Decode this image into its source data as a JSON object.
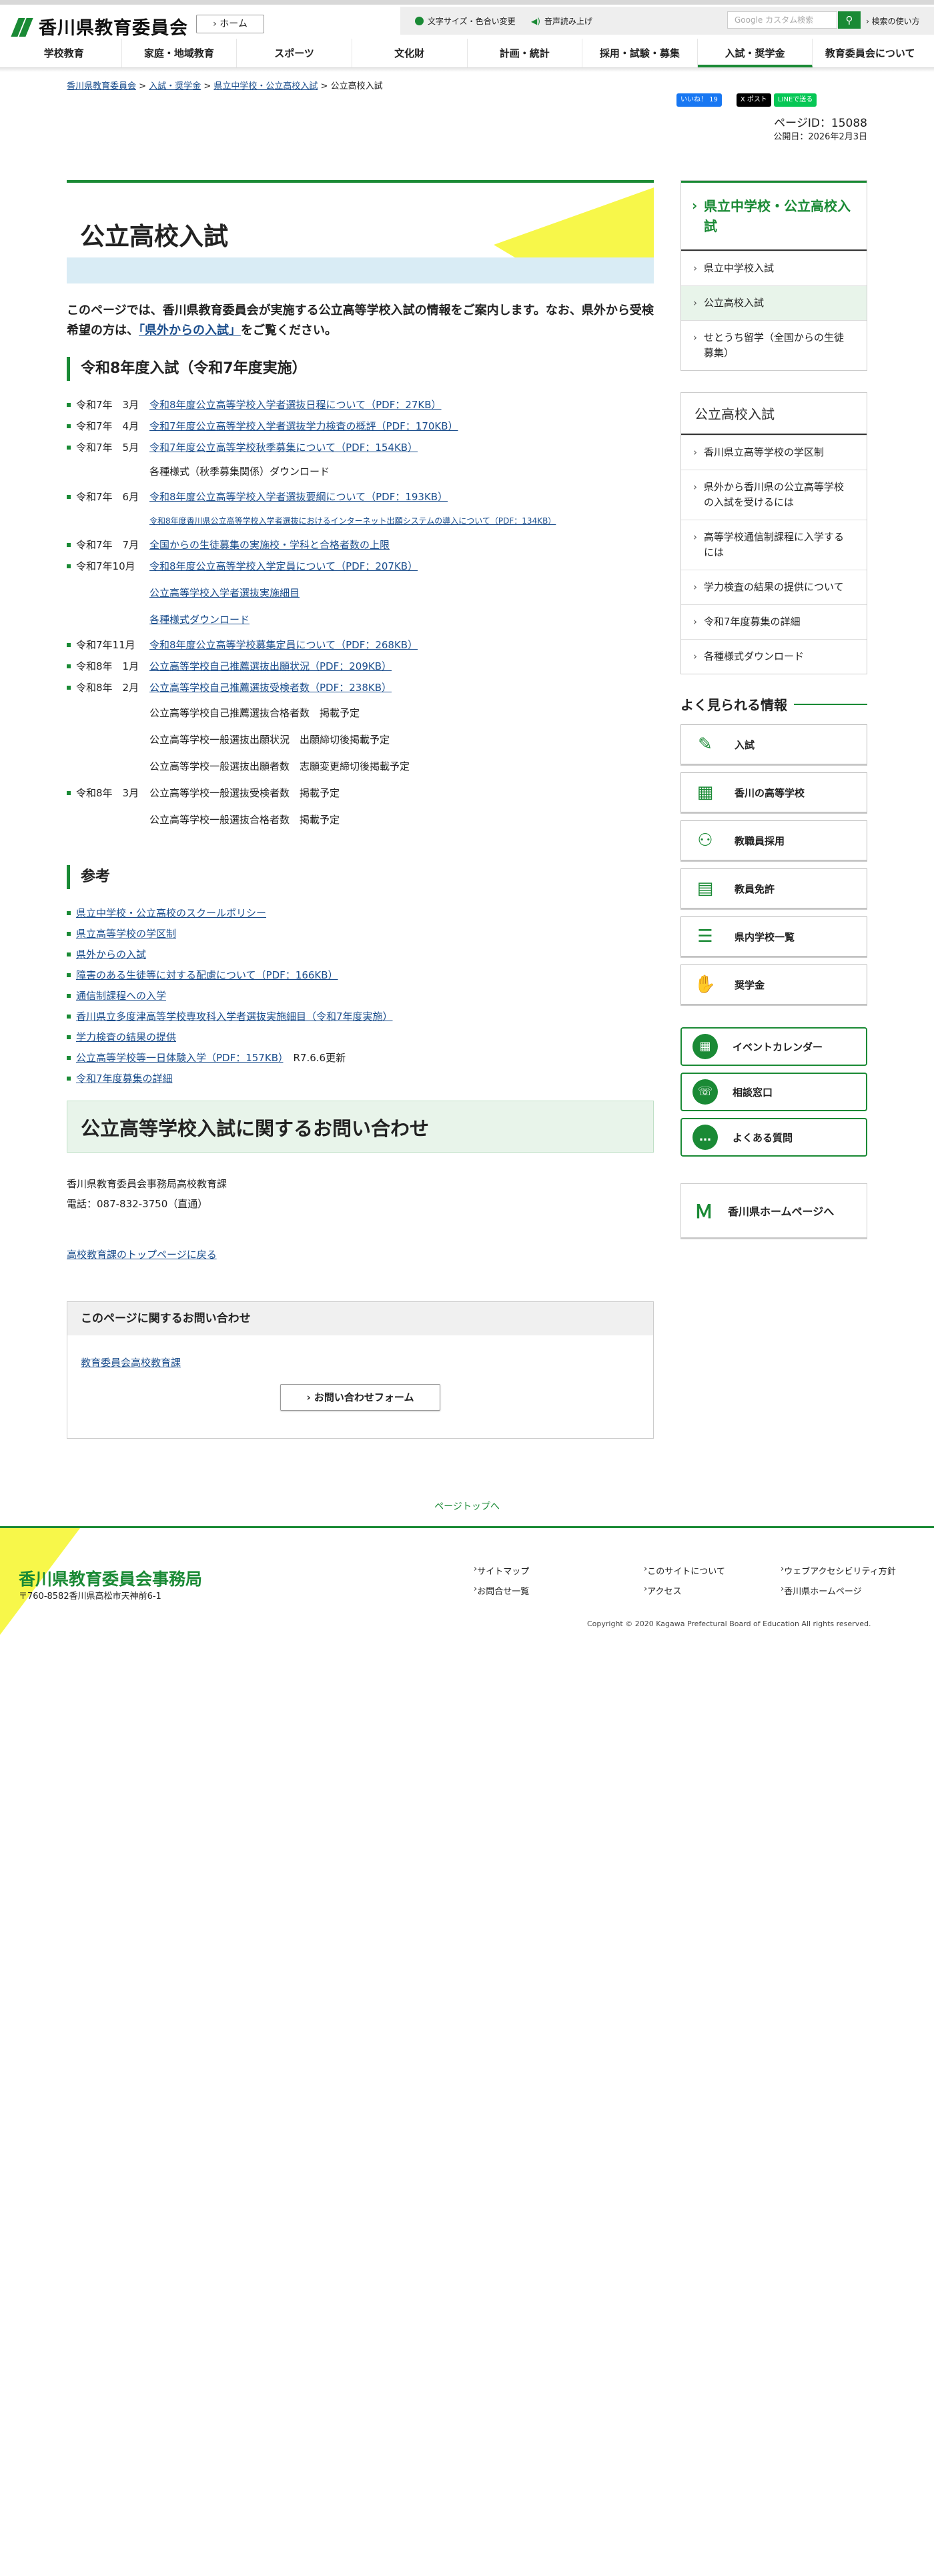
{
  "header": {
    "site_title": "香川県教育委員会",
    "home_label": "ホーム",
    "text_size": "文字サイズ・色合い変更",
    "voice": "音声読み上げ",
    "search_placeholder": "Google カスタム検索",
    "search_help": "検索の使い方"
  },
  "nav": [
    "学校教育",
    "家庭・地域教育",
    "スポーツ",
    "文化財",
    "計画・統計",
    "採用・試験・募集",
    "入試・奨学金",
    "教育委員会について"
  ],
  "breadcrumb": [
    "香川県教育委員会",
    "入試・奨学金",
    "県立中学校・公立高校入試",
    "公立高校入試"
  ],
  "sns": {
    "like": "いいね！ 19",
    "post": "X ポスト",
    "line": "LINEで送る"
  },
  "page_id": "ページID：15088",
  "published": "公開日：2026年2月3日",
  "main": {
    "title": "公立高校入試",
    "lead": "このページでは、香川県教育委員会が実施する公立高等学校入試の情報をご案内します。なお、県外から受検希望の方は、",
    "lead_link": "「県外からの入試」",
    "lead_end": "をご覧ください。",
    "section_title": "令和8年度入試（令和7年度実施）",
    "items": [
      {
        "date": "令和7年　3月",
        "text": "令和8年度公立高等学校入学者選抜日程について（PDF：27KB）"
      },
      {
        "date": "令和7年　4月",
        "text": "令和7年度公立高等学校入学者選抜学力検査の概評（PDF：170KB）"
      },
      {
        "date": "令和7年　5月",
        "text": "令和7年度公立高等学校秋季募集について（PDF：154KB）"
      },
      {
        "date": "令和7年　6月",
        "text": "令和8年度公立高等学校入学者選抜要綱について（PDF：193KB）"
      },
      {
        "date": "令和7年　7月",
        "text": "全国からの生徒募集の実施校・学科と合格者数の上限"
      },
      {
        "date": "令和7年10月",
        "text": "令和8年度公立高等学校入学定員について（PDF：207KB）"
      },
      {
        "date": "令和7年11月",
        "text": "令和8年度公立高等学校募集定員について（PDF：268KB）"
      },
      {
        "date": "令和8年　1月",
        "text": "公立高等学校自己推薦選抜出願状況（PDF：209KB）"
      },
      {
        "date": "令和8年　2月",
        "text": "公立高等学校自己推薦選抜受検者数（PDF：238KB）"
      },
      {
        "date": "令和8年　3月",
        "text": "公立高等学校一般選抜受検者数　掲載予定"
      }
    ],
    "sub_autumn": "各種様式（秋季募集関係）ダウンロード",
    "sub_internet": "令和8年度香川県公立高等学校入学者選抜におけるインターネット出願システムの導入について（PDF：134KB）",
    "sub_oct1": "公立高等学校入学者選抜実施細目",
    "sub_oct2": "各種様式ダウンロード",
    "sub_feb1": "公立高等学校自己推薦選抜合格者数　掲載予定",
    "sub_feb2": "公立高等学校一般選抜出願状況　出願締切後掲載予定",
    "sub_feb3": "公立高等学校一般選抜出願者数　志願変更締切後掲載予定",
    "sub_mar1": "公立高等学校一般選抜合格者数　掲載予定",
    "ref_title": "参考",
    "refs": [
      "県立中学校・公立高校のスクールポリシー",
      "県立高等学校の学区制",
      "県外からの入試",
      "障害のある生徒等に対する配慮について（PDF：166KB）",
      "通信制課程への入学",
      "香川県立多度津高等学校専攻科入学者選抜実施細目（令和7年度実施）",
      "学力検査の結果の提供",
      "公立高等学校等一日体験入学（PDF：157KB）",
      "令和7年度募集の詳細"
    ],
    "ref_note": "R7.6.6更新",
    "contact_title": "公立高等学校入試に関するお問い合わせ",
    "contact_org": "香川県教育委員会事務局高校教育課",
    "contact_tel": "電話：087-832-3750（直通）",
    "top_link": "高校教育課のトップページに戻る",
    "inq_title": "このページに関するお問い合わせ",
    "inq_link": "教育委員会高校教育課",
    "inq_btn": "お問い合わせフォーム"
  },
  "side": {
    "nav1_title": "県立中学校・公立高校入試",
    "nav1": [
      "県立中学校入試",
      "公立高校入試",
      "せとうち留学（全国からの生徒募集）"
    ],
    "nav2_title": "公立高校入試",
    "nav2": [
      "香川県立高等学校の学区制",
      "県外から香川県の公立高等学校の入試を受けるには",
      "高等学校通信制課程に入学するには",
      "学力検査の結果の提供について",
      "令和7年度募集の詳細",
      "各種様式ダウンロード"
    ],
    "freq_title": "よく見られる情報",
    "freq": [
      "入試",
      "香川の高等学校",
      "教職員採用",
      "教員免許",
      "県内学校一覧",
      "奨学金"
    ],
    "green": [
      "イベントカレンダー",
      "相談窓口",
      "よくある質問"
    ],
    "pref": "香川県ホームページへ"
  },
  "footer": {
    "page_top": "ページトップへ",
    "org": "香川県教育委員会事務局",
    "address": "〒760-8582香川県高松市天神前6-1",
    "links": [
      "サイトマップ",
      "このサイトについて",
      "ウェブアクセシビリティ方針",
      "お問合せ一覧",
      "アクセス",
      "香川県ホームページ"
    ],
    "copyright": "Copyright © 2020 Kagawa Prefectural Board of Education All rights reserved."
  }
}
